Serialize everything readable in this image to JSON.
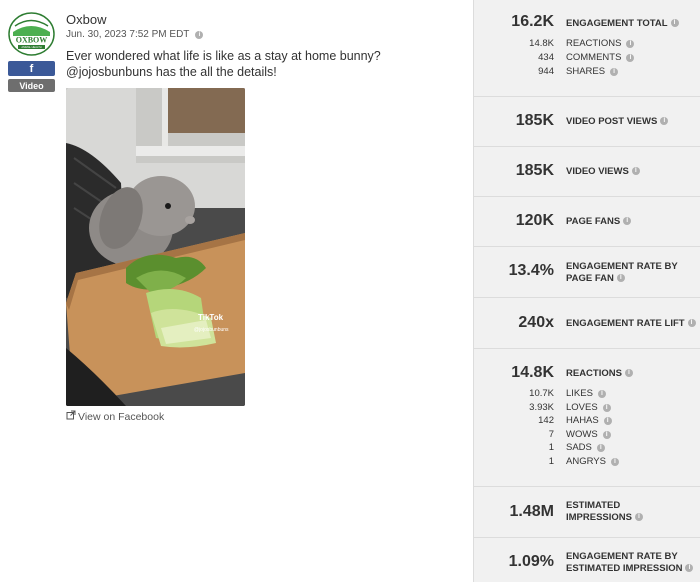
{
  "post": {
    "page_name": "Oxbow",
    "date": "Jun. 30, 2023 7:52 PM EDT",
    "caption": "Ever wondered what life is like as a stay at home bunny? @jojosbunbuns has the all the details!",
    "network_badge": "f",
    "type_badge": "Video",
    "view_link": "View on Facebook",
    "media_watermark": "TikTok",
    "media_handle": "@jojosbunbuns",
    "logo_text": "OXBOW",
    "logo_subtext": "ANIMAL HEALTH"
  },
  "metrics": {
    "engagement_total": {
      "value": "16.2K",
      "label": "Engagement Total",
      "breakdown": [
        {
          "value": "14.8K",
          "label": "Reactions"
        },
        {
          "value": "434",
          "label": "Comments"
        },
        {
          "value": "944",
          "label": "Shares"
        }
      ]
    },
    "video_post_views": {
      "value": "185K",
      "label": "Video Post Views"
    },
    "video_views": {
      "value": "185K",
      "label": "Video Views"
    },
    "page_fans": {
      "value": "120K",
      "label": "Page Fans"
    },
    "engagement_rate_fan": {
      "value": "13.4%",
      "label_line1": "Engagement Rate By",
      "label_line2": "Page Fan"
    },
    "engagement_rate_lift": {
      "value": "240x",
      "label": "Engagement Rate Lift"
    },
    "reactions": {
      "value": "14.8K",
      "label": "Reactions",
      "breakdown": [
        {
          "value": "10.7K",
          "label": "Likes"
        },
        {
          "value": "3.93K",
          "label": "Loves"
        },
        {
          "value": "142",
          "label": "Hahas"
        },
        {
          "value": "7",
          "label": "Wows"
        },
        {
          "value": "1",
          "label": "Sads"
        },
        {
          "value": "1",
          "label": "Angrys"
        }
      ]
    },
    "estimated_impressions": {
      "value": "1.48M",
      "label_line1": "Estimated",
      "label_line2": "Impressions"
    },
    "engagement_rate_impression": {
      "value": "1.09%",
      "label_line1": "Engagement Rate By",
      "label_line2": "Estimated Impression"
    }
  },
  "colors": {
    "facebook": "#3b5998",
    "panel_bg": "#f1f1f1",
    "info_icon": "#b0b0b0"
  },
  "icons": {
    "info": "info-icon",
    "external_link": "external-link-icon"
  }
}
